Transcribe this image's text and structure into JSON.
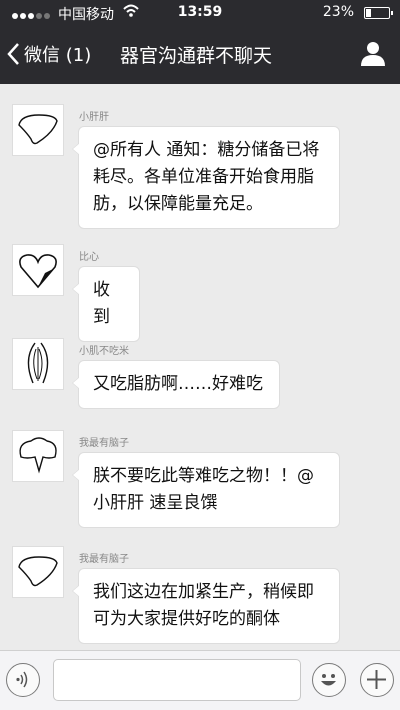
{
  "status_bar": {
    "carrier": "中国移动",
    "time": "13:59",
    "battery_percent": "23%",
    "battery_level": 0.23
  },
  "nav": {
    "back_label": "微信 (1)",
    "title": "器官沟通群不聊天"
  },
  "messages": [
    {
      "sender": "小肝肝",
      "avatar_icon": "liver-avatar-icon",
      "lines": [
        "@所有人 通知：糖分储备已将",
        "耗尽。各单位准备开始食用脂",
        "肪，以保障能量充足。"
      ]
    },
    {
      "sender": "比心",
      "avatar_icon": "heart-avatar-icon",
      "lines": [
        "收到"
      ]
    },
    {
      "sender": "小肌不吃米",
      "avatar_icon": "muscle-avatar-icon",
      "lines": [
        "又吃脂肪啊……好难吃"
      ]
    },
    {
      "sender": "我最有脑子",
      "avatar_icon": "brain-avatar-icon",
      "lines": [
        "朕不要吃此等难吃之物！！@",
        "小肝肝 速呈良馔"
      ]
    },
    {
      "sender": "我最有脑子",
      "avatar_icon": "liver-avatar-icon",
      "lines": [
        "我们这边在加紧生产，稍候即",
        "可为大家提供好吃的酮体"
      ]
    }
  ],
  "input_bar": {
    "voice_icon": "voice-icon",
    "emoji_icon": "emoji-icon",
    "plus_icon": "plus-icon"
  }
}
